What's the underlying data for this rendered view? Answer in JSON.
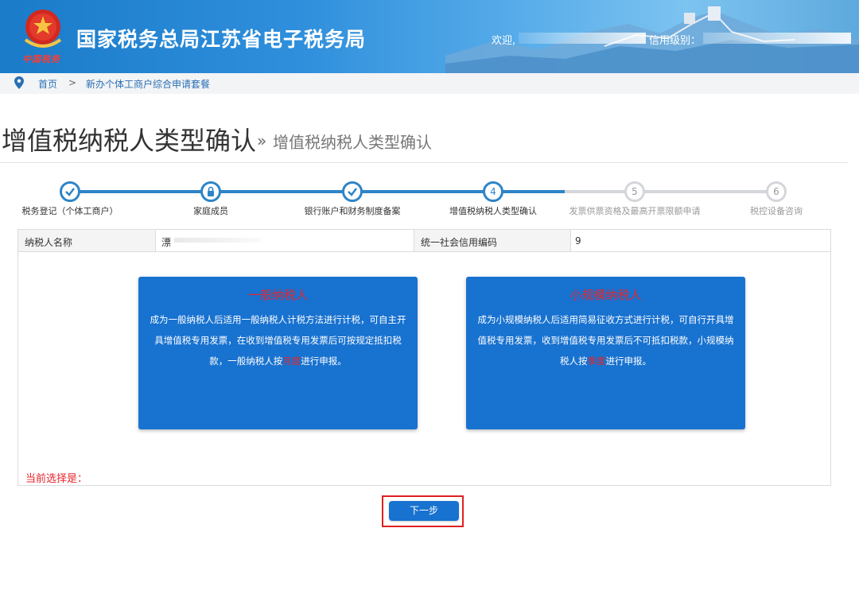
{
  "header": {
    "title": "国家税务总局江苏省电子税务局",
    "brand_sub": "中国税务",
    "welcome": "欢迎,",
    "credit_level": "信用级别："
  },
  "breadcrumb": {
    "home": "首页",
    "separator": ">",
    "current": "新办个体工商户综合申请套餐"
  },
  "page": {
    "title": "增值税纳税人类型确认",
    "arrow": "»",
    "subtitle": "增值税纳税人类型确认"
  },
  "steps": [
    {
      "label": "税务登记（个体工商户）",
      "status": "done",
      "icon": "check-icon"
    },
    {
      "label": "家庭成员",
      "status": "done",
      "icon": "lock-icon"
    },
    {
      "label": "银行账户和财务制度备案",
      "status": "done",
      "icon": "check-icon"
    },
    {
      "label": "增值税纳税人类型确认",
      "status": "current",
      "number": "4"
    },
    {
      "label": "发票供票资格及最高开票限额申请",
      "status": "todo",
      "number": "5"
    },
    {
      "label": "税控设备咨询",
      "status": "todo",
      "number": "6"
    }
  ],
  "info": {
    "taxpayer_name_label": "纳税人名称",
    "taxpayer_name_value": "漂",
    "credit_code_label": "统一社会信用编码",
    "credit_code_value": "9"
  },
  "cards": {
    "general": {
      "title": "一般纳税人",
      "body_before": "成为一般纳税人后适用一般纳税人计税方法进行计税，可自主开具增值税专用发票，在收到增值税专用发票后可按规定抵扣税款，一般纳税人按",
      "highlight": "月度",
      "body_after": "进行申报。"
    },
    "small": {
      "title": "小规模纳税人",
      "body_before": "成为小规模纳税人后适用简易征收方式进行计税，可自行开具增值税专用发票，收到增值税专用发票后不可抵扣税款，小规模纳税人按",
      "highlight": "季度",
      "body_after": "进行申报。"
    }
  },
  "current_selection_label": "当前选择是：",
  "next_button": "下一步",
  "colors": {
    "primary": "#1872d0",
    "step_done": "#2e84c6",
    "step_todo": "#d3d6da",
    "highlight": "#e8242a"
  }
}
